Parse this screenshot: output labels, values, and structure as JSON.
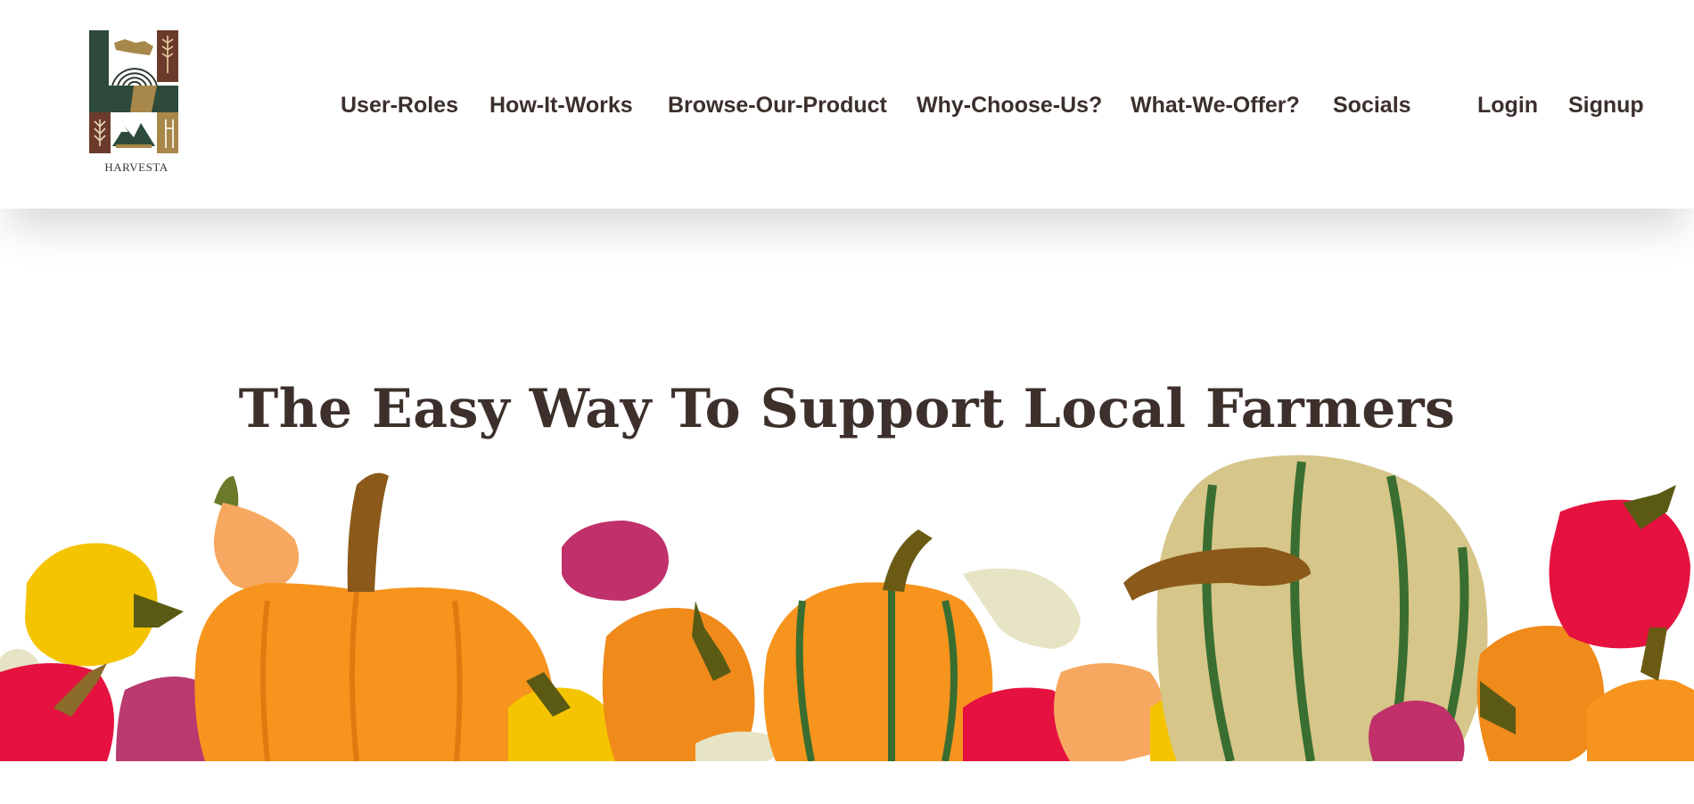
{
  "brand": {
    "name": "HARVESTA",
    "logo_icon": "harvesta-logo-icon"
  },
  "nav": {
    "items": [
      {
        "label": "User-Roles"
      },
      {
        "label": "How-It-Works"
      },
      {
        "label": "Browse-Our-Product"
      },
      {
        "label": "Why-Choose-Us?"
      },
      {
        "label": "What-We-Offer?"
      },
      {
        "label": "Socials"
      }
    ],
    "login_label": "Login",
    "signup_label": "Signup"
  },
  "hero": {
    "title": "The Easy Way To Support Local Farmers",
    "illustration": "vegetables-illustration"
  },
  "colors": {
    "text": "#3b2f2c",
    "logo_green": "#2d4a3a",
    "logo_brown": "#6b3a2a",
    "logo_gold": "#a8874a",
    "pumpkin": "#f7941d",
    "pepper_red": "#e5123f",
    "pepper_yellow": "#f5c400"
  }
}
